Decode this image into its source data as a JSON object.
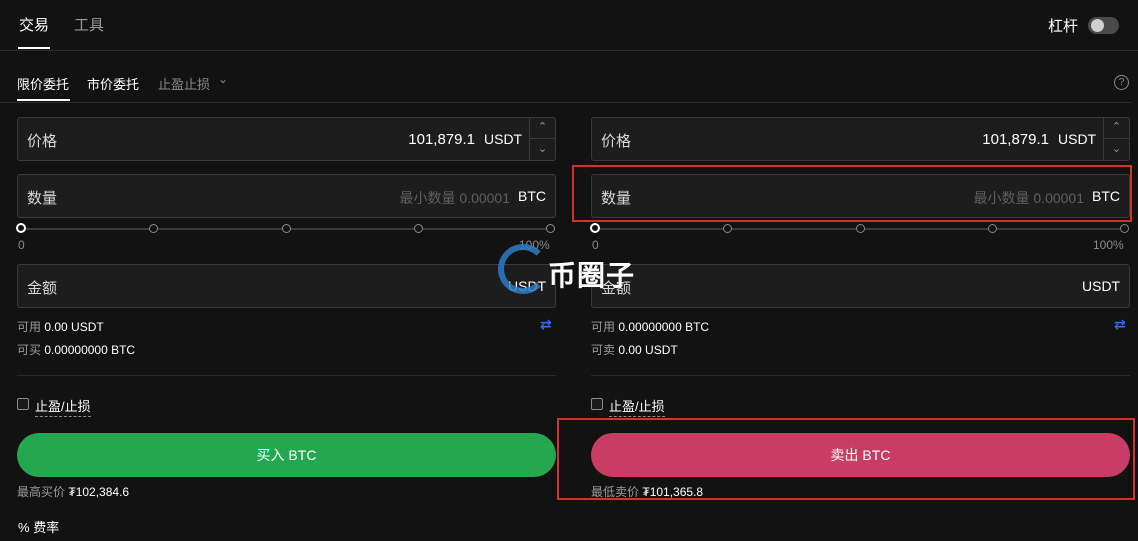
{
  "top_tabs": {
    "trade": "交易",
    "tools": "工具"
  },
  "leverage": {
    "label": "杠杆"
  },
  "order_tabs": {
    "limit": "限价委托",
    "market": "市价委托",
    "tpsl": "止盈止损"
  },
  "help": {
    "glyph": "?"
  },
  "buy": {
    "price_label": "价格",
    "price_value": "101,879.1",
    "price_unit": "USDT",
    "qty_label": "数量",
    "qty_placeholder": "最小数量 0.00001",
    "qty_unit": "BTC",
    "slider_min": "0",
    "slider_max": "100%",
    "amount_label": "金额",
    "amount_unit": "USDT",
    "avail_label": "可用",
    "avail_value": "0.00 USDT",
    "can_label": "可买",
    "can_value": "0.00000000 BTC",
    "tpsl_label": "止盈/止损",
    "button": "买入 BTC",
    "best_label": "最高买价",
    "best_value": "₮102,384.6"
  },
  "sell": {
    "price_label": "价格",
    "price_value": "101,879.1",
    "price_unit": "USDT",
    "qty_label": "数量",
    "qty_placeholder": "最小数量 0.00001",
    "qty_unit": "BTC",
    "slider_min": "0",
    "slider_max": "100%",
    "amount_label": "金额",
    "amount_unit": "USDT",
    "avail_label": "可用",
    "avail_value": "0.00000000 BTC",
    "can_label": "可卖",
    "can_value": "0.00 USDT",
    "tpsl_label": "止盈/止损",
    "button": "卖出 BTC",
    "best_label": "最低卖价",
    "best_value": "₮101,365.8"
  },
  "fee": {
    "icon": "%",
    "label": "费率"
  },
  "watermark": {
    "text": "币圈子"
  },
  "icons": {
    "chevron": "chevron-down-icon",
    "swap": "swap-icon",
    "help": "help-icon"
  },
  "colors": {
    "buy": "#25a750",
    "sell": "#c93c63",
    "highlight": "#d6302b",
    "swap": "#2d6bff"
  }
}
